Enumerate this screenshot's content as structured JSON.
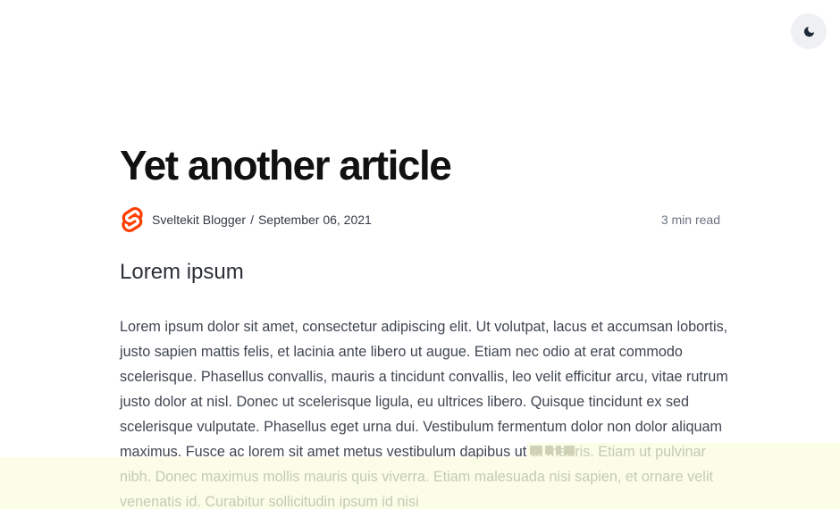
{
  "header": {
    "theme_toggle_icon": "moon-icon"
  },
  "article": {
    "title": "Yet another article",
    "author": "Sveltekit Blogger",
    "separator": "/",
    "date": "September 06, 2021",
    "read_time": "3 min read",
    "avatar_icon": "svelte-logo-icon",
    "heading": "Lorem ipsum",
    "paragraph": "Lorem ipsum dolor sit amet, consectetur adipiscing elit. Ut volutpat, lacus et accumsan lobortis, justo sapien mattis felis, et lacinia ante libero ut augue. Etiam nec odio at erat commodo scelerisque. Phasellus convallis, mauris a tincidunt convallis, leo velit efficitur arcu, vitae rutrum justo dolor at nisl. Donec ut scelerisque ligula, eu ultrices libero. Quisque tincidunt ex sed scelerisque vulputate. Phasellus eget urna dui. Vestibulum fermentum dolor non dolor aliquam maximus. Fusce ac lorem sit amet metus vestibulum dapibus ut at mauris. Etiam ut pulvinar nibh. Donec maximus mollis mauris quis viverra. Etiam malesuada nisi sapien, et ornare velit venenatis id. Curabitur sollicitudin ipsum id nisi"
  },
  "colors": {
    "accent": "#ff3e00",
    "toggle_bg": "#eef0f3",
    "banner_bg": "#f9fcdd"
  }
}
